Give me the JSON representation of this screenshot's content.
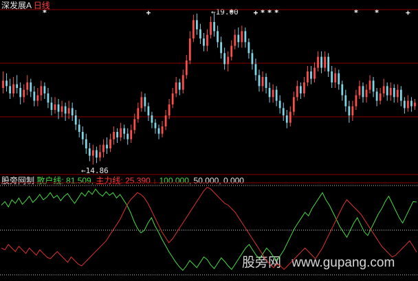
{
  "header": {
    "stock_name": "深发展A",
    "period": "日线"
  },
  "indicator": {
    "name": "股旁网制",
    "retail_text": "散户线: 81.509,",
    "main_text": "主力线: 25.390",
    "arrow": "↓",
    "level_100": "100.000,",
    "level_50": "50.000,",
    "level_0": "0.000"
  },
  "annotations": {
    "high_arrow": "←",
    "high_value": "19.00",
    "low_arrow": "←",
    "low_value": "14.86"
  },
  "watermark": {
    "cn": "股旁网",
    "url": "www.gupang.com"
  },
  "colors": {
    "background": "#000000",
    "up": "#ff4d4d",
    "down": "#7fd6e6",
    "grid": "#8b0000",
    "retail_line": "#44dd44",
    "main_line": "#e03030",
    "signal": "#ffffff"
  },
  "chart_data": [
    {
      "type": "candlestick",
      "title": "深发展A 日线",
      "annotations": [
        {
          "label": "19.00",
          "kind": "high"
        },
        {
          "label": "14.86",
          "kind": "low"
        }
      ],
      "ylim": [
        14.7,
        19.2
      ],
      "grid": true,
      "bar_count": 120,
      "candles": [
        [
          16.95,
          17.15,
          17.4,
          16.8
        ],
        [
          17.15,
          17.0,
          17.35,
          16.85
        ],
        [
          17.0,
          16.8,
          17.2,
          16.65
        ],
        [
          16.8,
          17.05,
          17.25,
          16.7
        ],
        [
          17.05,
          16.95,
          17.3,
          16.8
        ],
        [
          16.95,
          16.7,
          17.1,
          16.5
        ],
        [
          16.7,
          16.9,
          17.05,
          16.55
        ],
        [
          16.9,
          17.1,
          17.3,
          16.75
        ],
        [
          17.1,
          16.85,
          17.2,
          16.7
        ],
        [
          16.85,
          16.6,
          17.0,
          16.45
        ],
        [
          16.6,
          16.75,
          16.95,
          16.45
        ],
        [
          16.75,
          17.0,
          17.15,
          16.6
        ],
        [
          17.0,
          16.8,
          17.1,
          16.65
        ],
        [
          16.8,
          16.55,
          16.95,
          16.4
        ],
        [
          16.55,
          16.35,
          16.7,
          16.2
        ],
        [
          16.35,
          16.5,
          16.7,
          16.25
        ],
        [
          16.5,
          16.3,
          16.65,
          16.1
        ],
        [
          16.3,
          16.45,
          16.6,
          16.15
        ],
        [
          16.45,
          16.25,
          16.55,
          16.05
        ],
        [
          16.25,
          16.4,
          16.6,
          16.1
        ],
        [
          16.4,
          16.2,
          16.55,
          16.05
        ],
        [
          16.2,
          15.95,
          16.35,
          15.8
        ],
        [
          15.95,
          15.75,
          16.1,
          15.6
        ],
        [
          15.75,
          15.55,
          15.9,
          15.4
        ],
        [
          15.55,
          15.3,
          15.7,
          15.15
        ],
        [
          15.3,
          15.1,
          15.45,
          14.95
        ],
        [
          15.1,
          15.25,
          15.4,
          14.86
        ],
        [
          15.25,
          15.05,
          15.35,
          14.9
        ],
        [
          15.05,
          15.2,
          15.4,
          14.95
        ],
        [
          15.2,
          15.4,
          15.55,
          15.05
        ],
        [
          15.4,
          15.3,
          15.6,
          15.15
        ],
        [
          15.3,
          15.55,
          15.7,
          15.2
        ],
        [
          15.55,
          15.75,
          15.9,
          15.4
        ],
        [
          15.75,
          15.6,
          15.85,
          15.45
        ],
        [
          15.6,
          15.85,
          16.0,
          15.5
        ],
        [
          15.85,
          15.7,
          15.95,
          15.55
        ],
        [
          15.7,
          15.55,
          15.85,
          15.4
        ],
        [
          15.55,
          15.8,
          15.95,
          15.45
        ],
        [
          15.8,
          16.1,
          16.25,
          15.7
        ],
        [
          16.1,
          16.4,
          16.55,
          16.0
        ],
        [
          16.4,
          16.7,
          16.85,
          16.3
        ],
        [
          16.7,
          16.45,
          16.8,
          16.3
        ],
        [
          16.45,
          16.2,
          16.55,
          16.05
        ],
        [
          16.2,
          16.0,
          16.3,
          15.85
        ],
        [
          16.0,
          15.85,
          16.1,
          15.7
        ],
        [
          15.85,
          15.7,
          15.95,
          15.55
        ],
        [
          15.7,
          15.9,
          16.05,
          15.6
        ],
        [
          15.9,
          16.2,
          16.35,
          15.8
        ],
        [
          16.2,
          16.5,
          16.65,
          16.1
        ],
        [
          16.5,
          16.8,
          16.95,
          16.4
        ],
        [
          16.8,
          17.1,
          17.25,
          16.7
        ],
        [
          17.1,
          16.9,
          17.2,
          16.75
        ],
        [
          16.9,
          17.3,
          17.45,
          16.8
        ],
        [
          17.3,
          17.7,
          17.85,
          17.2
        ],
        [
          17.7,
          18.3,
          18.5,
          17.6
        ],
        [
          18.3,
          18.8,
          18.95,
          18.2
        ],
        [
          18.8,
          18.55,
          18.98,
          18.4
        ],
        [
          18.55,
          18.3,
          18.7,
          18.15
        ],
        [
          18.3,
          18.1,
          18.45,
          17.95
        ],
        [
          18.1,
          18.4,
          18.55,
          17.95
        ],
        [
          18.4,
          18.75,
          18.9,
          18.3
        ],
        [
          18.75,
          18.5,
          19.0,
          18.35
        ],
        [
          18.5,
          18.2,
          18.65,
          18.05
        ],
        [
          18.2,
          17.9,
          18.35,
          17.75
        ],
        [
          17.9,
          17.6,
          18.05,
          17.45
        ],
        [
          17.6,
          17.8,
          17.95,
          17.4
        ],
        [
          17.8,
          18.1,
          18.25,
          17.7
        ],
        [
          18.1,
          18.4,
          18.55,
          18.0
        ],
        [
          18.4,
          18.2,
          18.6,
          18.05
        ],
        [
          18.2,
          18.5,
          18.65,
          18.05
        ],
        [
          18.5,
          18.2,
          18.6,
          18.05
        ],
        [
          18.2,
          17.9,
          18.3,
          17.75
        ],
        [
          17.9,
          17.6,
          18.0,
          17.45
        ],
        [
          17.6,
          17.3,
          17.75,
          17.15
        ],
        [
          17.3,
          17.0,
          17.45,
          16.85
        ],
        [
          17.0,
          17.25,
          17.4,
          16.85
        ],
        [
          17.25,
          16.95,
          17.35,
          16.8
        ],
        [
          16.95,
          16.7,
          17.1,
          16.55
        ],
        [
          16.7,
          16.9,
          17.05,
          16.55
        ],
        [
          16.9,
          16.6,
          17.0,
          16.45
        ],
        [
          16.6,
          16.4,
          16.75,
          16.25
        ],
        [
          16.4,
          16.2,
          16.55,
          16.05
        ],
        [
          16.2,
          16.0,
          16.35,
          15.85
        ],
        [
          16.0,
          16.3,
          16.45,
          15.9
        ],
        [
          16.3,
          16.7,
          16.85,
          16.2
        ],
        [
          16.7,
          17.0,
          17.15,
          16.6
        ],
        [
          17.0,
          16.8,
          17.1,
          16.65
        ],
        [
          16.8,
          17.1,
          17.25,
          16.7
        ],
        [
          17.1,
          17.4,
          17.55,
          17.0
        ],
        [
          17.4,
          17.2,
          17.55,
          17.05
        ],
        [
          17.2,
          17.5,
          17.65,
          17.1
        ],
        [
          17.5,
          17.8,
          17.95,
          17.4
        ],
        [
          17.8,
          17.5,
          17.95,
          17.35
        ],
        [
          17.5,
          17.8,
          17.95,
          17.4
        ],
        [
          17.8,
          17.4,
          17.9,
          17.25
        ],
        [
          17.4,
          17.1,
          17.55,
          16.95
        ],
        [
          17.1,
          17.35,
          17.5,
          16.95
        ],
        [
          17.35,
          17.05,
          17.45,
          16.9
        ],
        [
          17.05,
          16.75,
          17.15,
          16.6
        ],
        [
          16.75,
          16.45,
          16.9,
          16.3
        ],
        [
          16.45,
          16.2,
          16.6,
          16.0
        ],
        [
          16.2,
          16.45,
          16.6,
          16.05
        ],
        [
          16.45,
          16.75,
          16.9,
          16.35
        ],
        [
          16.75,
          17.0,
          17.15,
          16.65
        ],
        [
          17.0,
          16.7,
          17.1,
          16.55
        ],
        [
          16.7,
          16.9,
          17.05,
          16.55
        ],
        [
          16.9,
          17.15,
          17.3,
          16.8
        ],
        [
          17.15,
          16.85,
          17.25,
          16.7
        ],
        [
          16.85,
          16.6,
          16.95,
          16.45
        ],
        [
          16.6,
          16.8,
          16.95,
          16.5
        ],
        [
          16.8,
          17.0,
          17.2,
          16.7
        ],
        [
          17.0,
          16.75,
          17.1,
          16.6
        ],
        [
          16.75,
          16.95,
          17.1,
          16.6
        ],
        [
          16.95,
          16.7,
          17.05,
          16.55
        ],
        [
          16.7,
          16.9,
          17.05,
          16.55
        ],
        [
          16.9,
          16.6,
          17.0,
          16.45
        ],
        [
          16.6,
          16.4,
          16.7,
          16.25
        ],
        [
          16.4,
          16.6,
          16.75,
          16.3
        ],
        [
          16.6,
          16.45,
          16.7,
          16.3
        ],
        [
          16.45,
          16.55,
          16.65,
          16.35
        ]
      ],
      "signal_markers": [
        {
          "bar": 12,
          "symbol": "*"
        },
        {
          "bar": 42,
          "symbol": "+"
        },
        {
          "bar": 66,
          "symbol": "*"
        },
        {
          "bar": 73,
          "symbol": "+"
        },
        {
          "bar": 75,
          "symbol": "*"
        },
        {
          "bar": 77,
          "symbol": "*"
        },
        {
          "bar": 79,
          "symbol": "*"
        },
        {
          "bar": 102,
          "symbol": "*"
        },
        {
          "bar": 108,
          "symbol": "*"
        },
        {
          "bar": 117,
          "symbol": "+"
        }
      ]
    },
    {
      "type": "line",
      "title": "股旁网制",
      "ylim": [
        0,
        100
      ],
      "reference_levels": [
        100,
        50,
        0
      ],
      "series": [
        {
          "name": "散户线",
          "last": 81.509,
          "values": [
            78,
            82,
            76,
            84,
            80,
            86,
            79,
            83,
            88,
            81,
            85,
            90,
            84,
            87,
            92,
            86,
            89,
            83,
            88,
            91,
            85,
            80,
            86,
            92,
            88,
            94,
            90,
            96,
            91,
            88,
            93,
            89,
            92,
            86,
            90,
            84,
            78,
            70,
            60,
            52,
            47,
            50,
            58,
            64,
            55,
            48,
            40,
            33,
            26,
            20,
            14,
            9,
            5,
            10,
            16,
            12,
            8,
            14,
            20,
            17,
            11,
            7,
            13,
            19,
            15,
            10,
            6,
            12,
            18,
            24,
            30,
            34,
            28,
            22,
            18,
            24,
            30,
            26,
            20,
            16,
            22,
            28,
            36,
            44,
            52,
            58,
            64,
            70,
            66,
            74,
            80,
            86,
            92,
            84,
            78,
            70,
            62,
            54,
            48,
            42,
            50,
            58,
            64,
            56,
            48,
            44,
            52,
            60,
            68,
            74,
            82,
            88,
            80,
            72,
            64,
            58,
            66,
            74,
            82,
            81.509
          ]
        },
        {
          "name": "主力线",
          "last": 25.39,
          "values": [
            30,
            28,
            34,
            30,
            26,
            32,
            28,
            24,
            30,
            26,
            22,
            28,
            24,
            20,
            18,
            22,
            26,
            22,
            18,
            14,
            20,
            16,
            12,
            10,
            14,
            18,
            22,
            26,
            30,
            34,
            38,
            44,
            50,
            56,
            62,
            70,
            78,
            84,
            88,
            92,
            90,
            86,
            80,
            72,
            64,
            56,
            48,
            42,
            36,
            40,
            46,
            52,
            58,
            64,
            70,
            76,
            82,
            88,
            94,
            98,
            96,
            92,
            88,
            84,
            80,
            78,
            74,
            70,
            64,
            58,
            52,
            46,
            40,
            34,
            28,
            22,
            16,
            12,
            8,
            12,
            10,
            6,
            10,
            14,
            18,
            22,
            26,
            30,
            26,
            22,
            18,
            24,
            30,
            38,
            46,
            54,
            62,
            70,
            78,
            84,
            80,
            76,
            72,
            68,
            62,
            56,
            50,
            44,
            38,
            32,
            28,
            24,
            20,
            22,
            26,
            30,
            34,
            38,
            32,
            25.39
          ]
        }
      ]
    }
  ]
}
